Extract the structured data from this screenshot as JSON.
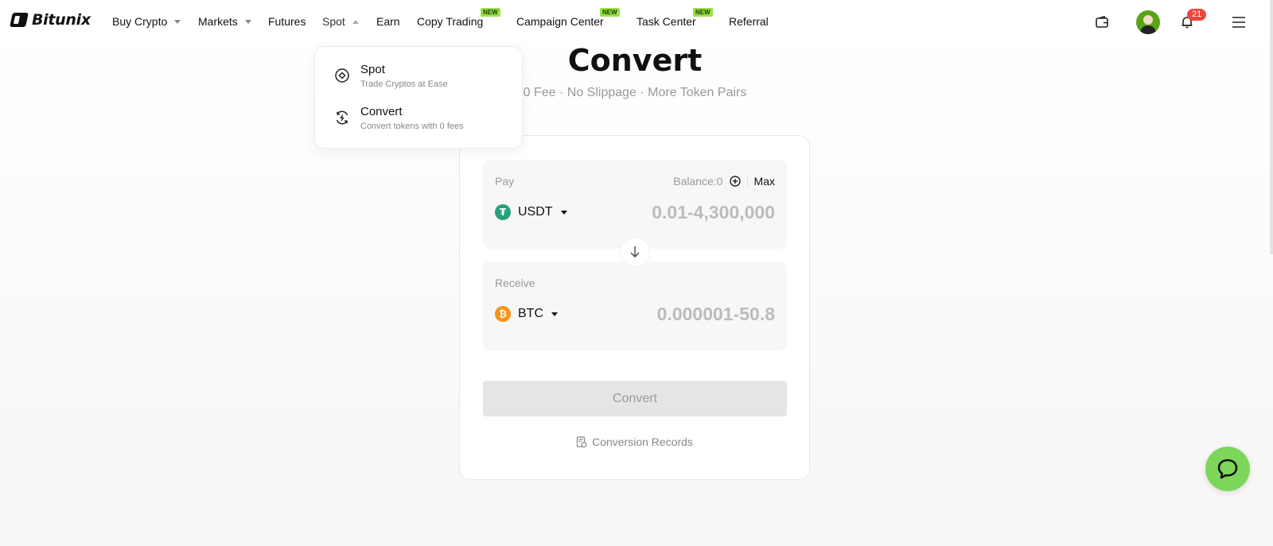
{
  "brand": {
    "name": "Bitunix"
  },
  "nav": {
    "items": [
      {
        "label": "Buy Crypto"
      },
      {
        "label": "Markets"
      },
      {
        "label": "Futures"
      },
      {
        "label": "Spot"
      },
      {
        "label": "Earn"
      },
      {
        "label": "Copy Trading"
      },
      {
        "label": "Campaign Center"
      },
      {
        "label": "Task Center"
      },
      {
        "label": "Referral"
      }
    ],
    "new_badge": "NEW",
    "notification_count": "21"
  },
  "spot_menu": {
    "items": [
      {
        "title": "Spot",
        "subtitle": "Trade Cryptos at Ease",
        "icon": "spot-target-icon"
      },
      {
        "title": "Convert",
        "subtitle": "Convert tokens with 0 fees",
        "icon": "convert-cycle-icon"
      }
    ]
  },
  "hero": {
    "title": "Convert",
    "subtitle": "0 Fee · No Slippage · More Token Pairs"
  },
  "pay": {
    "label": "Pay",
    "balance": "Balance:0",
    "max_label": "Max",
    "token": "USDT",
    "placeholder": "0.01-4,300,000"
  },
  "receive": {
    "label": "Receive",
    "token": "BTC",
    "placeholder": "0.000001-50.8"
  },
  "convert_button": "Convert",
  "records_link": "Conversion Records",
  "colors": {
    "accent_green": "#9be04a",
    "chat_green": "#7dd65a",
    "usdt": "#26a17b",
    "btc": "#f7931a",
    "badge_red": "#f2453d"
  }
}
